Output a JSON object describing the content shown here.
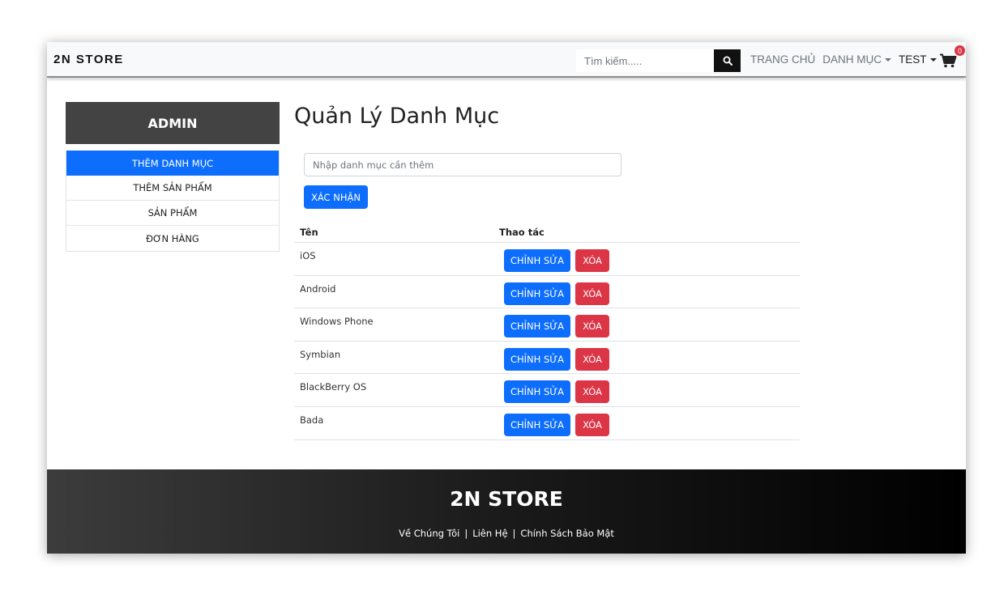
{
  "navbar": {
    "brand": "2N STORE",
    "search_placeholder": "Tìm kiếm.....",
    "links": [
      "TRANG CHỦ",
      "DANH MỤC",
      "TEST"
    ],
    "cart_count": "0"
  },
  "sidebar": {
    "title": "ADMIN",
    "items": [
      {
        "label": "THÊM DANH MỤC",
        "active": true
      },
      {
        "label": "THÊM SẢN PHẨM",
        "active": false
      },
      {
        "label": "SẢN PHẨM",
        "active": false
      },
      {
        "label": "ĐƠN HÀNG",
        "active": false
      }
    ]
  },
  "main": {
    "title": "Quản Lý Danh Mục",
    "input_placeholder": "Nhập danh mục cần thêm",
    "confirm_label": "XÁC NHẬN",
    "table": {
      "headers": [
        "Tên",
        "Thao tác"
      ],
      "edit_label": "CHỈNH SỬA",
      "delete_label": "XÓA",
      "rows": [
        "iOS",
        "Android",
        "Windows Phone",
        "Symbian",
        "BlackBerry OS",
        "Bada"
      ]
    }
  },
  "footer": {
    "title": "2N STORE",
    "links": [
      "Về Chúng Tôi",
      "Liên Hệ",
      "Chính Sách Bảo Mật"
    ],
    "separator": "|"
  },
  "colors": {
    "primary": "#0d6efd",
    "danger": "#dc3545",
    "sidebar_header": "#434343"
  }
}
